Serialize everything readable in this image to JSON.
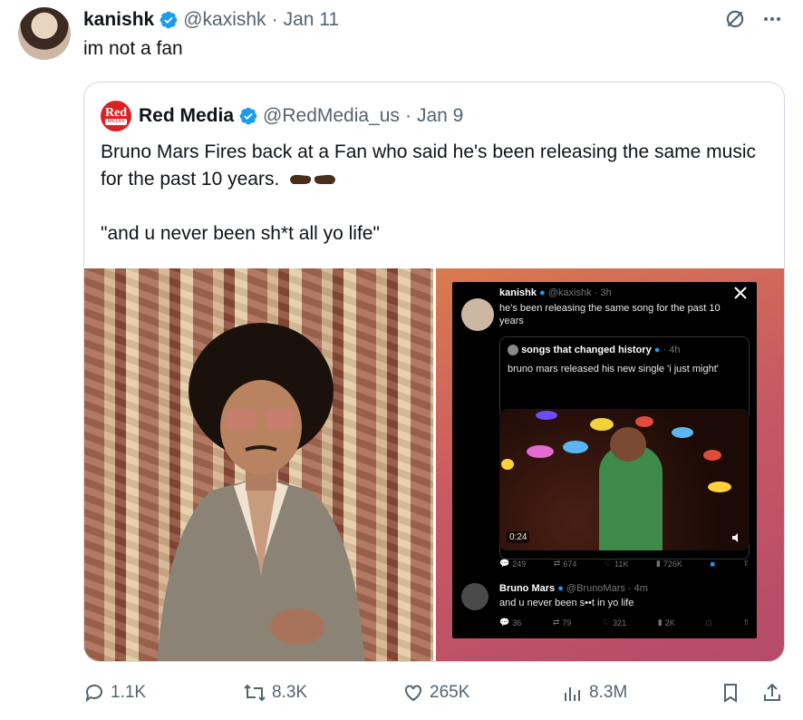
{
  "tweet": {
    "author_name": "kanishk",
    "handle": "@kaxishk",
    "date": "Jan 11",
    "text": "im not a fan",
    "icons": [
      "grok-icon",
      "more-icon"
    ]
  },
  "quote": {
    "logo_line1": "Red",
    "logo_line2": "MEDIA",
    "author_name": "Red Media",
    "handle": "@RedMedia_us",
    "date": "Jan 9",
    "text_line1": "Bruno Mars Fires back at a Fan who said he's been releasing the same music for the past 10 years.",
    "text_line2": "\"and u never been sh*t all yo life\"",
    "media": {
      "embedded_screenshot": {
        "tweet1_name": "kanishk",
        "tweet1_handle": "@kaxishk · 3h",
        "tweet1_text": "he's been releasing the same song for the past 10 years",
        "inner_quote_name": "songs that changed history",
        "inner_quote_time": "· 4h",
        "inner_quote_text": "bruno mars released his new single 'i just might'",
        "video_time": "0:24",
        "stats1": {
          "replies": "249",
          "reposts": "674",
          "likes": "11K",
          "views": "726K"
        },
        "tweet2_name": "Bruno Mars",
        "tweet2_handle": "@BrunoMars · 4m",
        "tweet2_text": "and u never been s••t in yo life",
        "stats2": {
          "replies": "36",
          "reposts": "79",
          "likes": "321",
          "views": "2K"
        }
      }
    }
  },
  "actions": {
    "replies": "1.1K",
    "reposts": "8.3K",
    "likes": "265K",
    "views": "8.3M"
  },
  "colors": {
    "verified": "#1d9bf0",
    "secondary_text": "#536471",
    "border": "#cfd9de",
    "brand_red": "#d92323"
  }
}
